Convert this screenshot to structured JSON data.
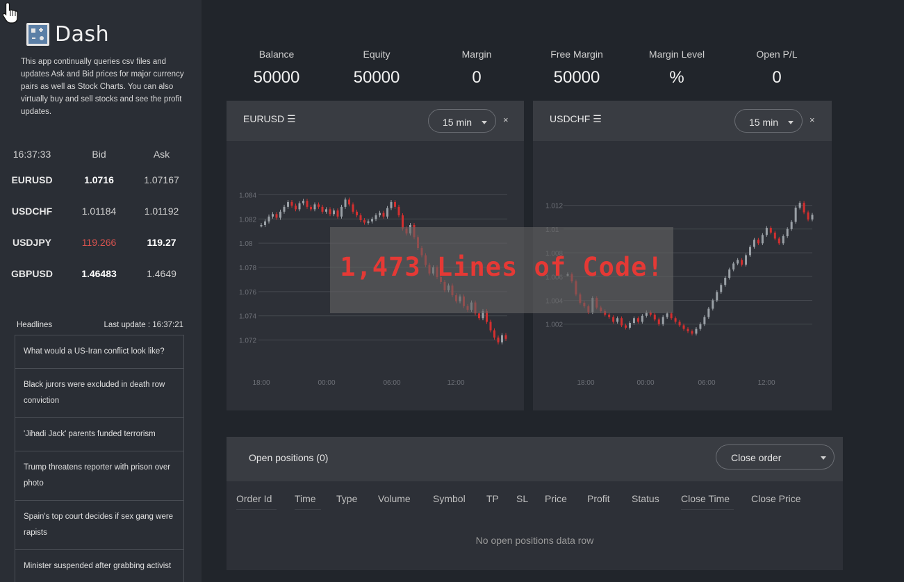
{
  "app": {
    "title": "Dash",
    "description": "This app continually queries csv files and updates Ask and Bid prices for major currency pairs as well as Stock Charts. You can also virtually buy and sell stocks and see the profit updates."
  },
  "quotes": {
    "time": "16:37:33",
    "bid_label": "Bid",
    "ask_label": "Ask",
    "rows": [
      {
        "symbol": "EURUSD",
        "bid": "1.0716",
        "ask": "1.07167"
      },
      {
        "symbol": "USDCHF",
        "bid": "1.01184",
        "ask": "1.01192"
      },
      {
        "symbol": "USDJPY",
        "bid": "119.266",
        "ask": "119.27"
      },
      {
        "symbol": "GBPUSD",
        "bid": "1.46483",
        "ask": "1.4649"
      }
    ]
  },
  "headlines": {
    "label": "Headlines",
    "last_update": "Last update : 16:37:21",
    "items": [
      "What would a US-Iran conflict look like?",
      "Black jurors were excluded in death row conviction",
      "'Jihadi Jack' parents funded terrorism",
      "Trump threatens reporter with prison over photo",
      "Spain's top court decides if sex gang were rapists",
      "Minister suspended after grabbing activist"
    ]
  },
  "stats": [
    {
      "label": "Balance",
      "value": "50000"
    },
    {
      "label": "Equity",
      "value": "50000"
    },
    {
      "label": "Margin",
      "value": "0"
    },
    {
      "label": "Free Margin",
      "value": "50000"
    },
    {
      "label": "Margin Level",
      "value": "%"
    },
    {
      "label": "Open P/L",
      "value": "0"
    }
  ],
  "charts": [
    {
      "title": "EURUSD ☰",
      "interval": "15 min",
      "close": "×"
    },
    {
      "title": "USDCHF ☰",
      "interval": "15 min",
      "close": "×"
    }
  ],
  "chart_data": [
    {
      "type": "candlestick",
      "symbol": "EURUSD",
      "title": "",
      "y_ticks": [
        "1.084",
        "1.082",
        "1.08",
        "1.078",
        "1.076",
        "1.074",
        "1.072"
      ],
      "x_ticks": [
        "18:00",
        "00:00",
        "06:00",
        "12:00"
      ],
      "ylim": [
        1.071,
        1.085
      ],
      "grid": true,
      "closes": [
        1.0815,
        1.0818,
        1.0822,
        1.0824,
        1.0821,
        1.0826,
        1.083,
        1.0834,
        1.0831,
        1.0828,
        1.0833,
        1.0835,
        1.083,
        1.0828,
        1.0832,
        1.083,
        1.0826,
        1.0828,
        1.0824,
        1.0827,
        1.0822,
        1.083,
        1.0836,
        1.0832,
        1.0826,
        1.0823,
        1.0819,
        1.0817,
        1.0818,
        1.082,
        1.0823,
        1.0825,
        1.0822,
        1.0829,
        1.0834,
        1.083,
        1.0823,
        1.0812,
        1.0808,
        1.0815,
        1.0805,
        1.0796,
        1.079,
        1.0782,
        1.0775,
        1.078,
        1.0772,
        1.0768,
        1.0761,
        1.0765,
        1.0757,
        1.0752,
        1.0756,
        1.0748,
        1.0745,
        1.0751,
        1.0742,
        1.0738,
        1.0744,
        1.0735,
        1.0728,
        1.0722,
        1.0718,
        1.0724,
        1.0721
      ],
      "series_colors": {
        "up": "#9aa0a6",
        "down": "#d32f2f"
      }
    },
    {
      "type": "candlestick",
      "symbol": "USDCHF",
      "title": "",
      "y_ticks": [
        "1.012",
        "1.01",
        "1.008",
        "1.006",
        "1.004",
        "1.002"
      ],
      "x_ticks": [
        "18:00",
        "00:00",
        "06:00",
        "12:00"
      ],
      "ylim": [
        1.0007,
        1.0132
      ],
      "grid": true,
      "closes": [
        1.0062,
        1.0056,
        1.0045,
        1.0038,
        1.0035,
        1.003,
        1.0042,
        1.0034,
        1.0031,
        1.0028,
        1.0026,
        1.0022,
        1.0025,
        1.0019,
        1.0017,
        1.0021,
        1.0025,
        1.0022,
        1.0027,
        1.003,
        1.0028,
        1.0024,
        1.002,
        1.0026,
        1.0029,
        1.0025,
        1.0022,
        1.0019,
        1.0016,
        1.0014,
        1.0012,
        1.0016,
        1.002,
        1.0026,
        1.0033,
        1.004,
        1.0047,
        1.0053,
        1.0059,
        1.0066,
        1.0071,
        1.0074,
        1.007,
        1.0078,
        1.0085,
        1.0091,
        1.0088,
        1.0095,
        1.0101,
        1.0097,
        1.0092,
        1.0088,
        1.0094,
        1.01,
        1.0106,
        1.0118,
        1.0122,
        1.0114,
        1.0108,
        1.0112
      ]
    }
  ],
  "overlay": {
    "text": "1,473 Lines of Code!"
  },
  "positions": {
    "title": "Open positions (0)",
    "action": "Close order",
    "columns": [
      "Order Id",
      "Time",
      "Type",
      "Volume",
      "Symbol",
      "TP",
      "SL",
      "Price",
      "Profit",
      "Status",
      "Close Time",
      "Close Price"
    ],
    "empty_text": "No open positions data row"
  },
  "colors": {
    "background": "#21252b",
    "sidebar": "#2a2e35",
    "panel": "#2d3037",
    "negative": "#d9534f",
    "overlay_text": "#e53935"
  }
}
